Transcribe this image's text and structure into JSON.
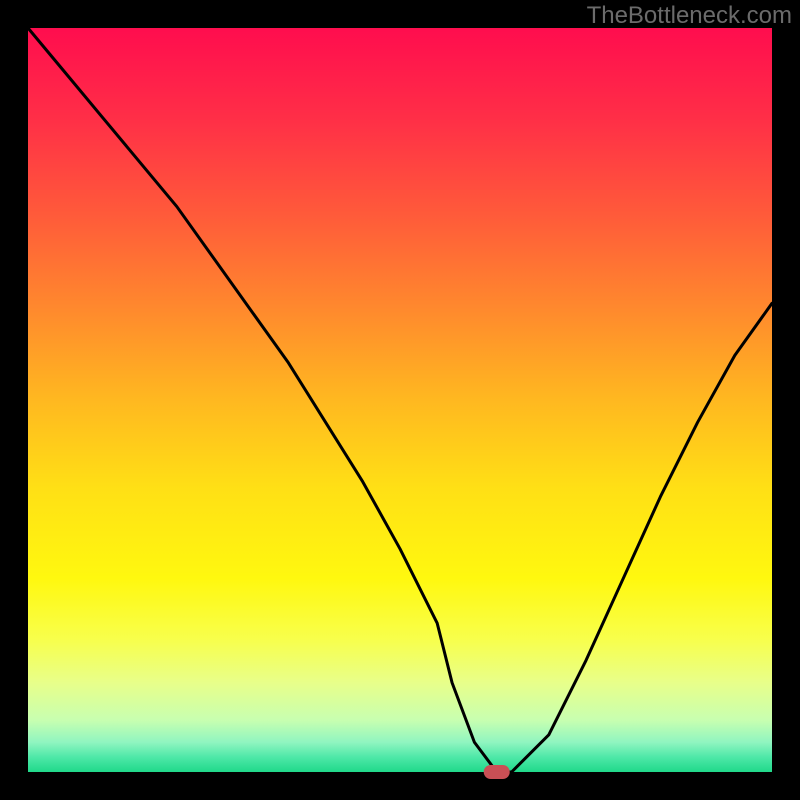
{
  "watermark": "TheBottleneck.com",
  "chart_data": {
    "type": "line",
    "title": "",
    "xlabel": "",
    "ylabel": "",
    "xlim": [
      0,
      100
    ],
    "ylim": [
      0,
      100
    ],
    "series": [
      {
        "name": "bottleneck-curve",
        "x": [
          0,
          5,
          10,
          15,
          20,
          25,
          30,
          35,
          40,
          45,
          50,
          55,
          57,
          60,
          63,
          65,
          70,
          75,
          80,
          85,
          90,
          95,
          100
        ],
        "y": [
          100,
          94,
          88,
          82,
          76,
          69,
          62,
          55,
          47,
          39,
          30,
          20,
          12,
          4,
          0,
          0,
          5,
          15,
          26,
          37,
          47,
          56,
          63
        ]
      }
    ],
    "marker": {
      "x": 63,
      "y": 0,
      "color": "#c94f55"
    },
    "gradient_stops": [
      {
        "offset": 0,
        "color": "#ff0d4e"
      },
      {
        "offset": 12,
        "color": "#ff2e47"
      },
      {
        "offset": 25,
        "color": "#ff5a3a"
      },
      {
        "offset": 38,
        "color": "#ff8a2d"
      },
      {
        "offset": 50,
        "color": "#ffb820"
      },
      {
        "offset": 62,
        "color": "#ffe015"
      },
      {
        "offset": 74,
        "color": "#fff80f"
      },
      {
        "offset": 82,
        "color": "#f8ff4a"
      },
      {
        "offset": 88,
        "color": "#e8ff8a"
      },
      {
        "offset": 93,
        "color": "#c8ffb0"
      },
      {
        "offset": 96,
        "color": "#90f5c0"
      },
      {
        "offset": 98,
        "color": "#4ee8a8"
      },
      {
        "offset": 100,
        "color": "#20d98a"
      }
    ],
    "frame_color": "#000000",
    "frame_width": 28
  }
}
